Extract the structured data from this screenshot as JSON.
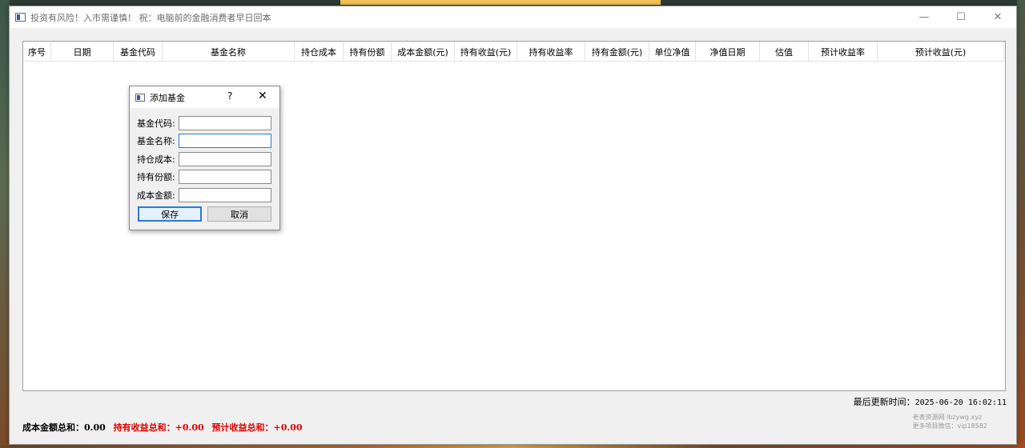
{
  "window": {
    "title": "投资有风险！入市需谨慎！ 祝：电脑前的金融消费者早日回本",
    "controls": {
      "minimize": "—",
      "maximize": "☐",
      "close": "✕"
    }
  },
  "table": {
    "columns": [
      "序号",
      "日期",
      "基金代码",
      "基金名称",
      "持仓成本",
      "持有份额",
      "成本金额(元)",
      "持有收益(元)",
      "持有收益率",
      "持有金额(元)",
      "单位净值",
      "净值日期",
      "估值",
      "预计收益率",
      "预计收益(元)"
    ],
    "rows": []
  },
  "status": {
    "last_update_label": "最后更新时间：",
    "last_update_value": "2025-06-20 16:02:11"
  },
  "summary": {
    "cost_total_label": "成本金额总和：",
    "cost_total_value": "0.00",
    "holding_profit_label": "持有收益总和：",
    "holding_profit_value": "+0.00",
    "expected_profit_label": "预计收益总和：",
    "expected_profit_value": "+0.00"
  },
  "watermark": {
    "line1": "老表资源网 lbzywg.xyz",
    "line2": "更多项目微信：vip18582"
  },
  "dialog": {
    "title": "添加基金",
    "help": "?",
    "close": "✕",
    "fields": [
      {
        "label": "基金代码:",
        "value": "",
        "placeholder": ""
      },
      {
        "label": "基金名称:",
        "value": "",
        "placeholder": ""
      },
      {
        "label": "持仓成本:",
        "value": "",
        "placeholder": ""
      },
      {
        "label": "持有份额:",
        "value": "",
        "placeholder": ""
      },
      {
        "label": "成本金额:",
        "value": "",
        "placeholder": ""
      }
    ],
    "save_label": "保存",
    "cancel_label": "取消"
  },
  "colors": {
    "accent_focus": "#2a7bd8",
    "summary_red": "#e00000"
  }
}
